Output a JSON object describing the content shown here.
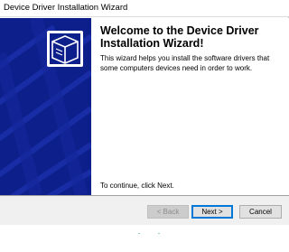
{
  "window": {
    "title": "Device Driver Installation Wizard"
  },
  "content": {
    "heading": "Welcome to the Device Driver Installation Wizard!",
    "description": "This wizard helps you install the software drivers that some computers devices need in order to work.",
    "continue_text": "To continue, click Next."
  },
  "buttons": {
    "back": {
      "label": "< Back",
      "enabled": false
    },
    "next": {
      "label": "Next >",
      "enabled": true,
      "default": true
    },
    "cancel": {
      "label": "Cancel",
      "enabled": true
    }
  },
  "banner": {
    "icon": "install-box-icon",
    "color": "#0d1f8a"
  }
}
